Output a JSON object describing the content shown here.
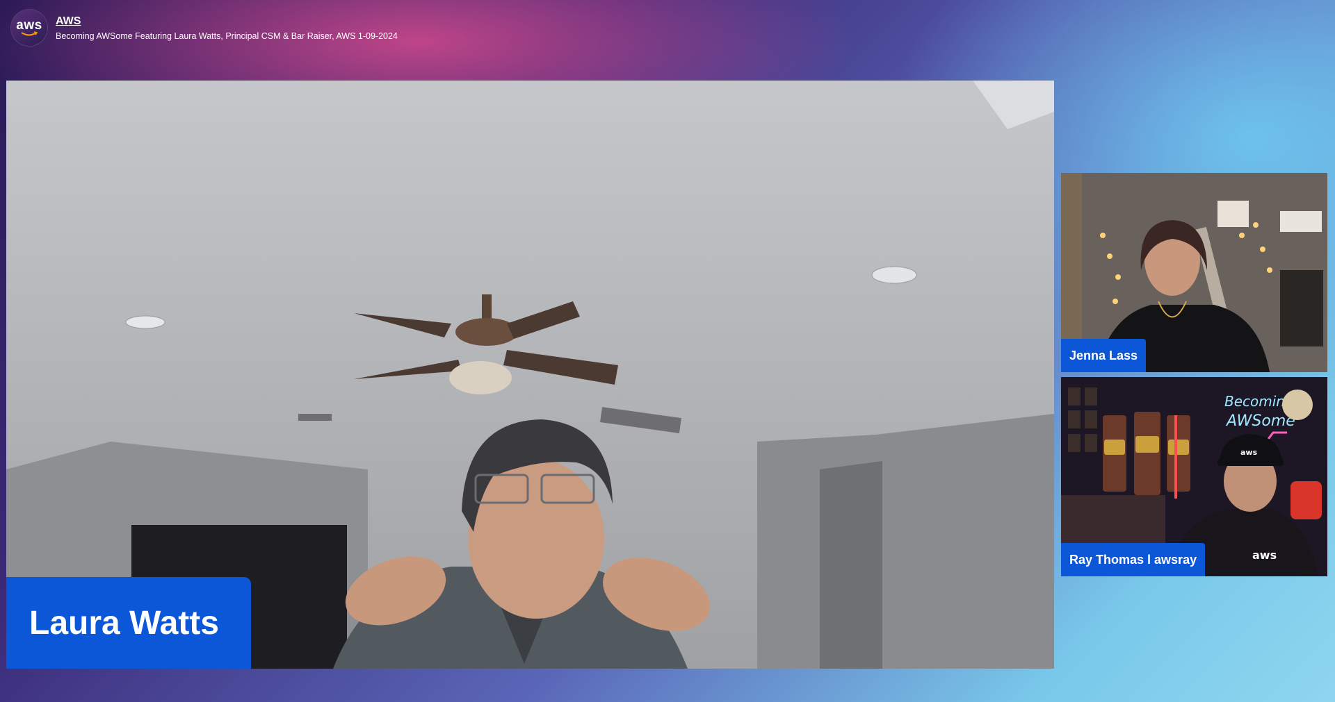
{
  "header": {
    "logo_text": "aws",
    "channel": "AWS",
    "subtitle": "Becoming AWSome Featuring Laura Watts, Principal CSM & Bar Raiser, AWS 1-09-2024"
  },
  "participants": {
    "main": {
      "name": "Laura Watts"
    },
    "tiles": [
      {
        "name": "Jenna Lass"
      },
      {
        "name": "Ray Thomas l awsray",
        "neon_sign": "Becoming AWSome",
        "hat_logo": "aws",
        "shirt_logo": "aws"
      }
    ]
  },
  "colors": {
    "name_tag": "#0b57d8",
    "accent_pink": "#d64a8c",
    "accent_cyan": "#8fd6ef"
  }
}
